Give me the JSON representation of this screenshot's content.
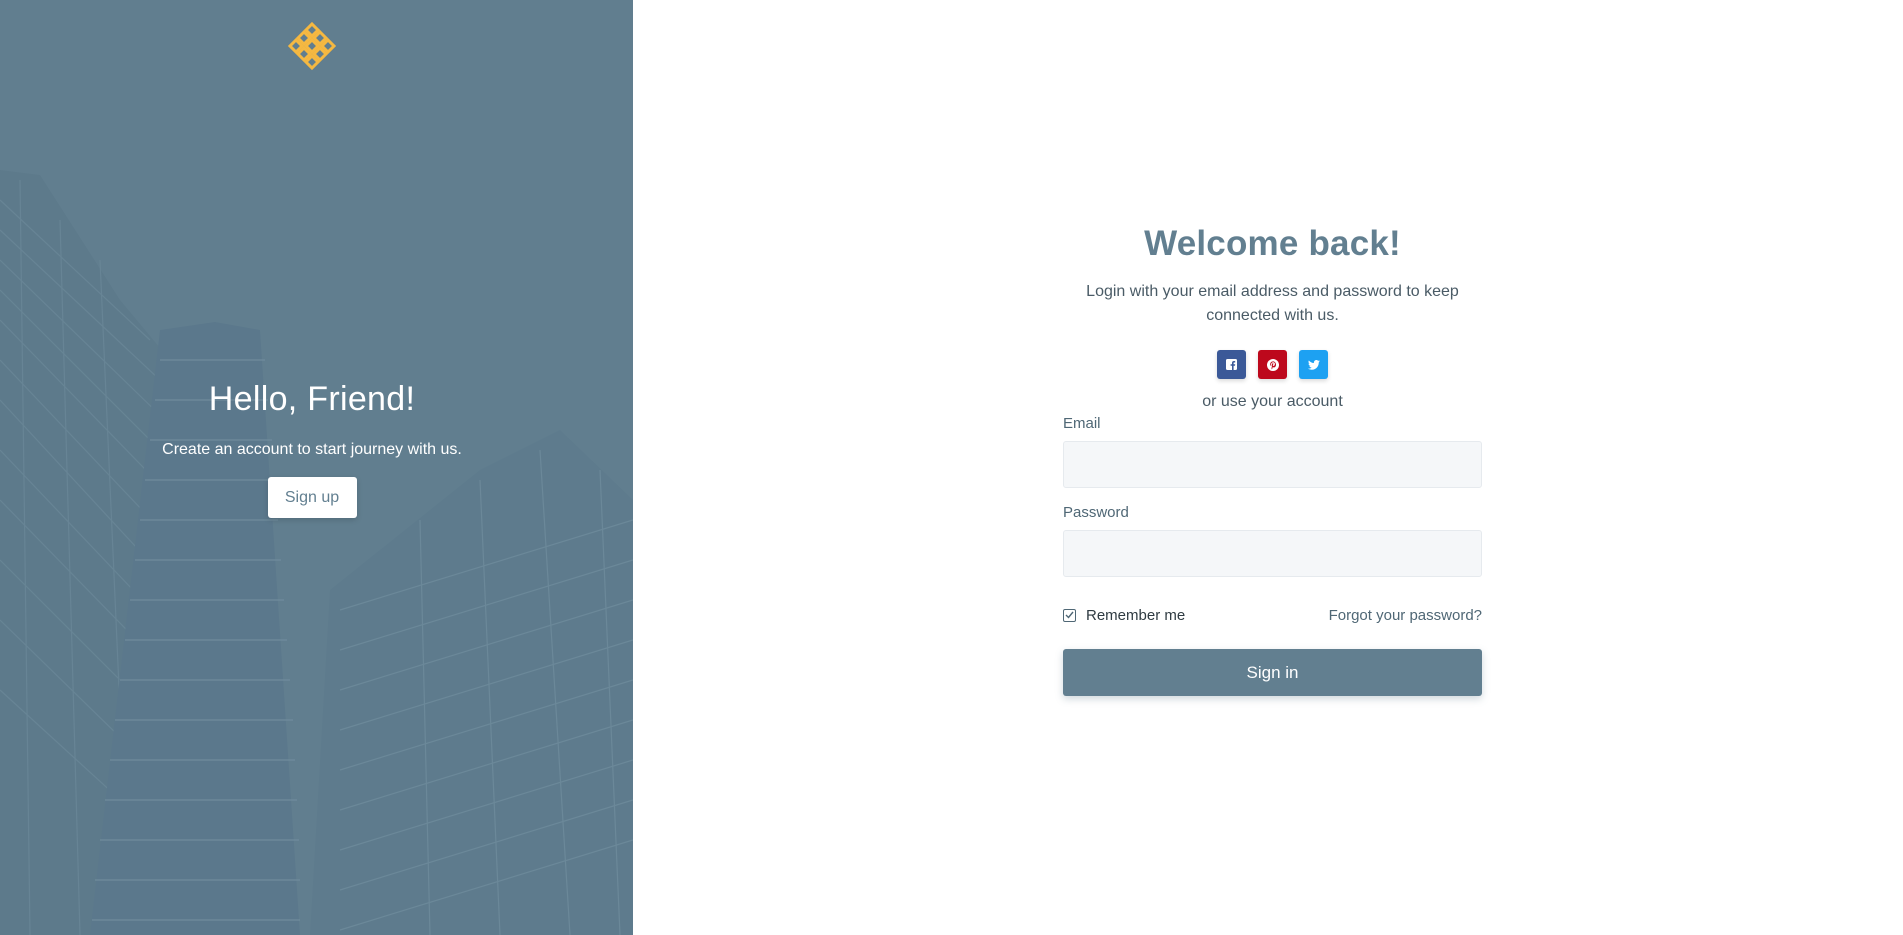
{
  "colors": {
    "primary": "#627f90",
    "logo": "#f5b841",
    "facebook": "#3b5998",
    "pinterest": "#bd081c",
    "twitter": "#1da1f2",
    "input_bg": "#f5f7f9"
  },
  "left": {
    "logo_icon": "knot-logo-icon",
    "title": "Hello, Friend!",
    "text": "Create an account to start journey with us.",
    "signup_label": "Sign up"
  },
  "login": {
    "title": "Welcome back!",
    "text": "Login with your email address and password to keep connected with us.",
    "social": [
      {
        "name": "facebook",
        "icon": "facebook-icon"
      },
      {
        "name": "pinterest",
        "icon": "pinterest-icon"
      },
      {
        "name": "twitter",
        "icon": "twitter-icon"
      }
    ],
    "or_text": "or use your account",
    "email_label": "Email",
    "email_value": "",
    "password_label": "Password",
    "password_value": "",
    "remember_label": "Remember me",
    "remember_checked": true,
    "forgot_label": "Forgot your password?",
    "signin_label": "Sign in"
  }
}
